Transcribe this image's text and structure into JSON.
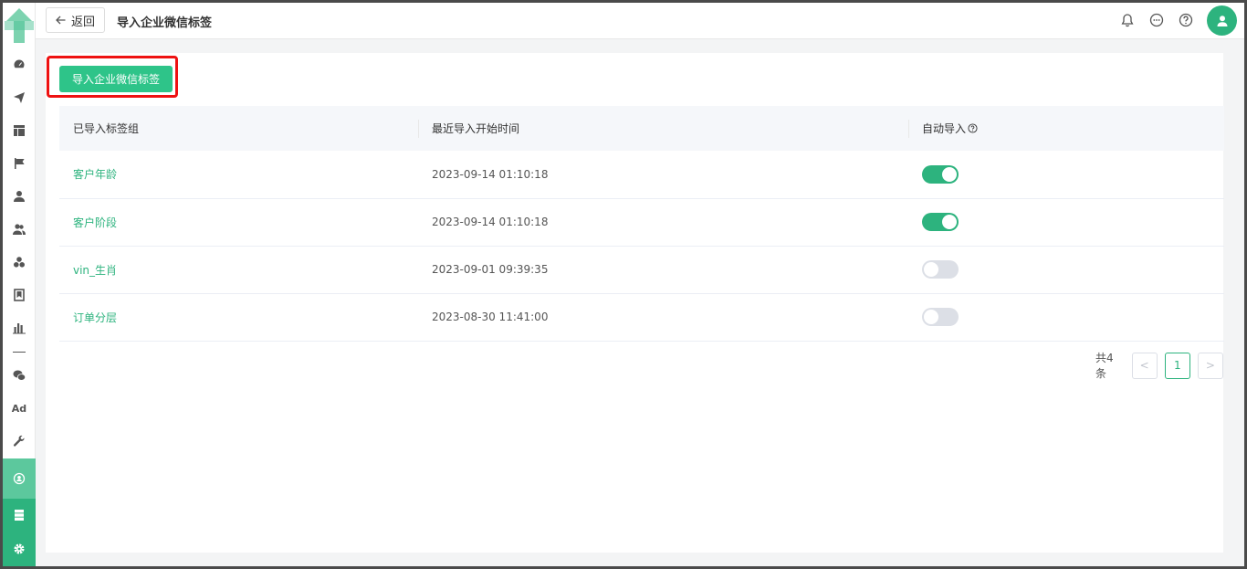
{
  "header": {
    "back_label": "返回",
    "title": "导入企业微信标签",
    "icons": [
      "bell-icon",
      "chat-icon",
      "help-icon",
      "user-avatar-icon"
    ]
  },
  "sidebar": {
    "items": [
      "dashboard-icon",
      "send-icon",
      "layout-icon",
      "flag-icon",
      "user-icon",
      "users-icon",
      "segments-icon",
      "bookmark-icon",
      "bar-chart-icon",
      "wechat-icon",
      "ad-icon",
      "wrench-icon",
      "hub-icon",
      "server-icon",
      "settings-icon"
    ],
    "ad_label": "Ad"
  },
  "toolbar": {
    "import_label": "导入企业微信标签"
  },
  "table": {
    "columns": [
      "已导入标签组",
      "最近导入开始时间",
      "自动导入"
    ],
    "rows": [
      {
        "name": "客户年龄",
        "time": "2023-09-14 01:10:18",
        "auto": true
      },
      {
        "name": "客户阶段",
        "time": "2023-09-14 01:10:18",
        "auto": true
      },
      {
        "name": "vin_生肖",
        "time": "2023-09-01 09:39:35",
        "auto": false
      },
      {
        "name": "订单分层",
        "time": "2023-08-30 11:41:00",
        "auto": false
      }
    ]
  },
  "pagination": {
    "total_label": "共4条",
    "current_page": "1",
    "prev": "<",
    "next": ">"
  },
  "colors": {
    "accent": "#2db37e",
    "switch_on": "#2db37e",
    "switch_off": "#dcdfe6",
    "highlight": "#ee1111"
  }
}
